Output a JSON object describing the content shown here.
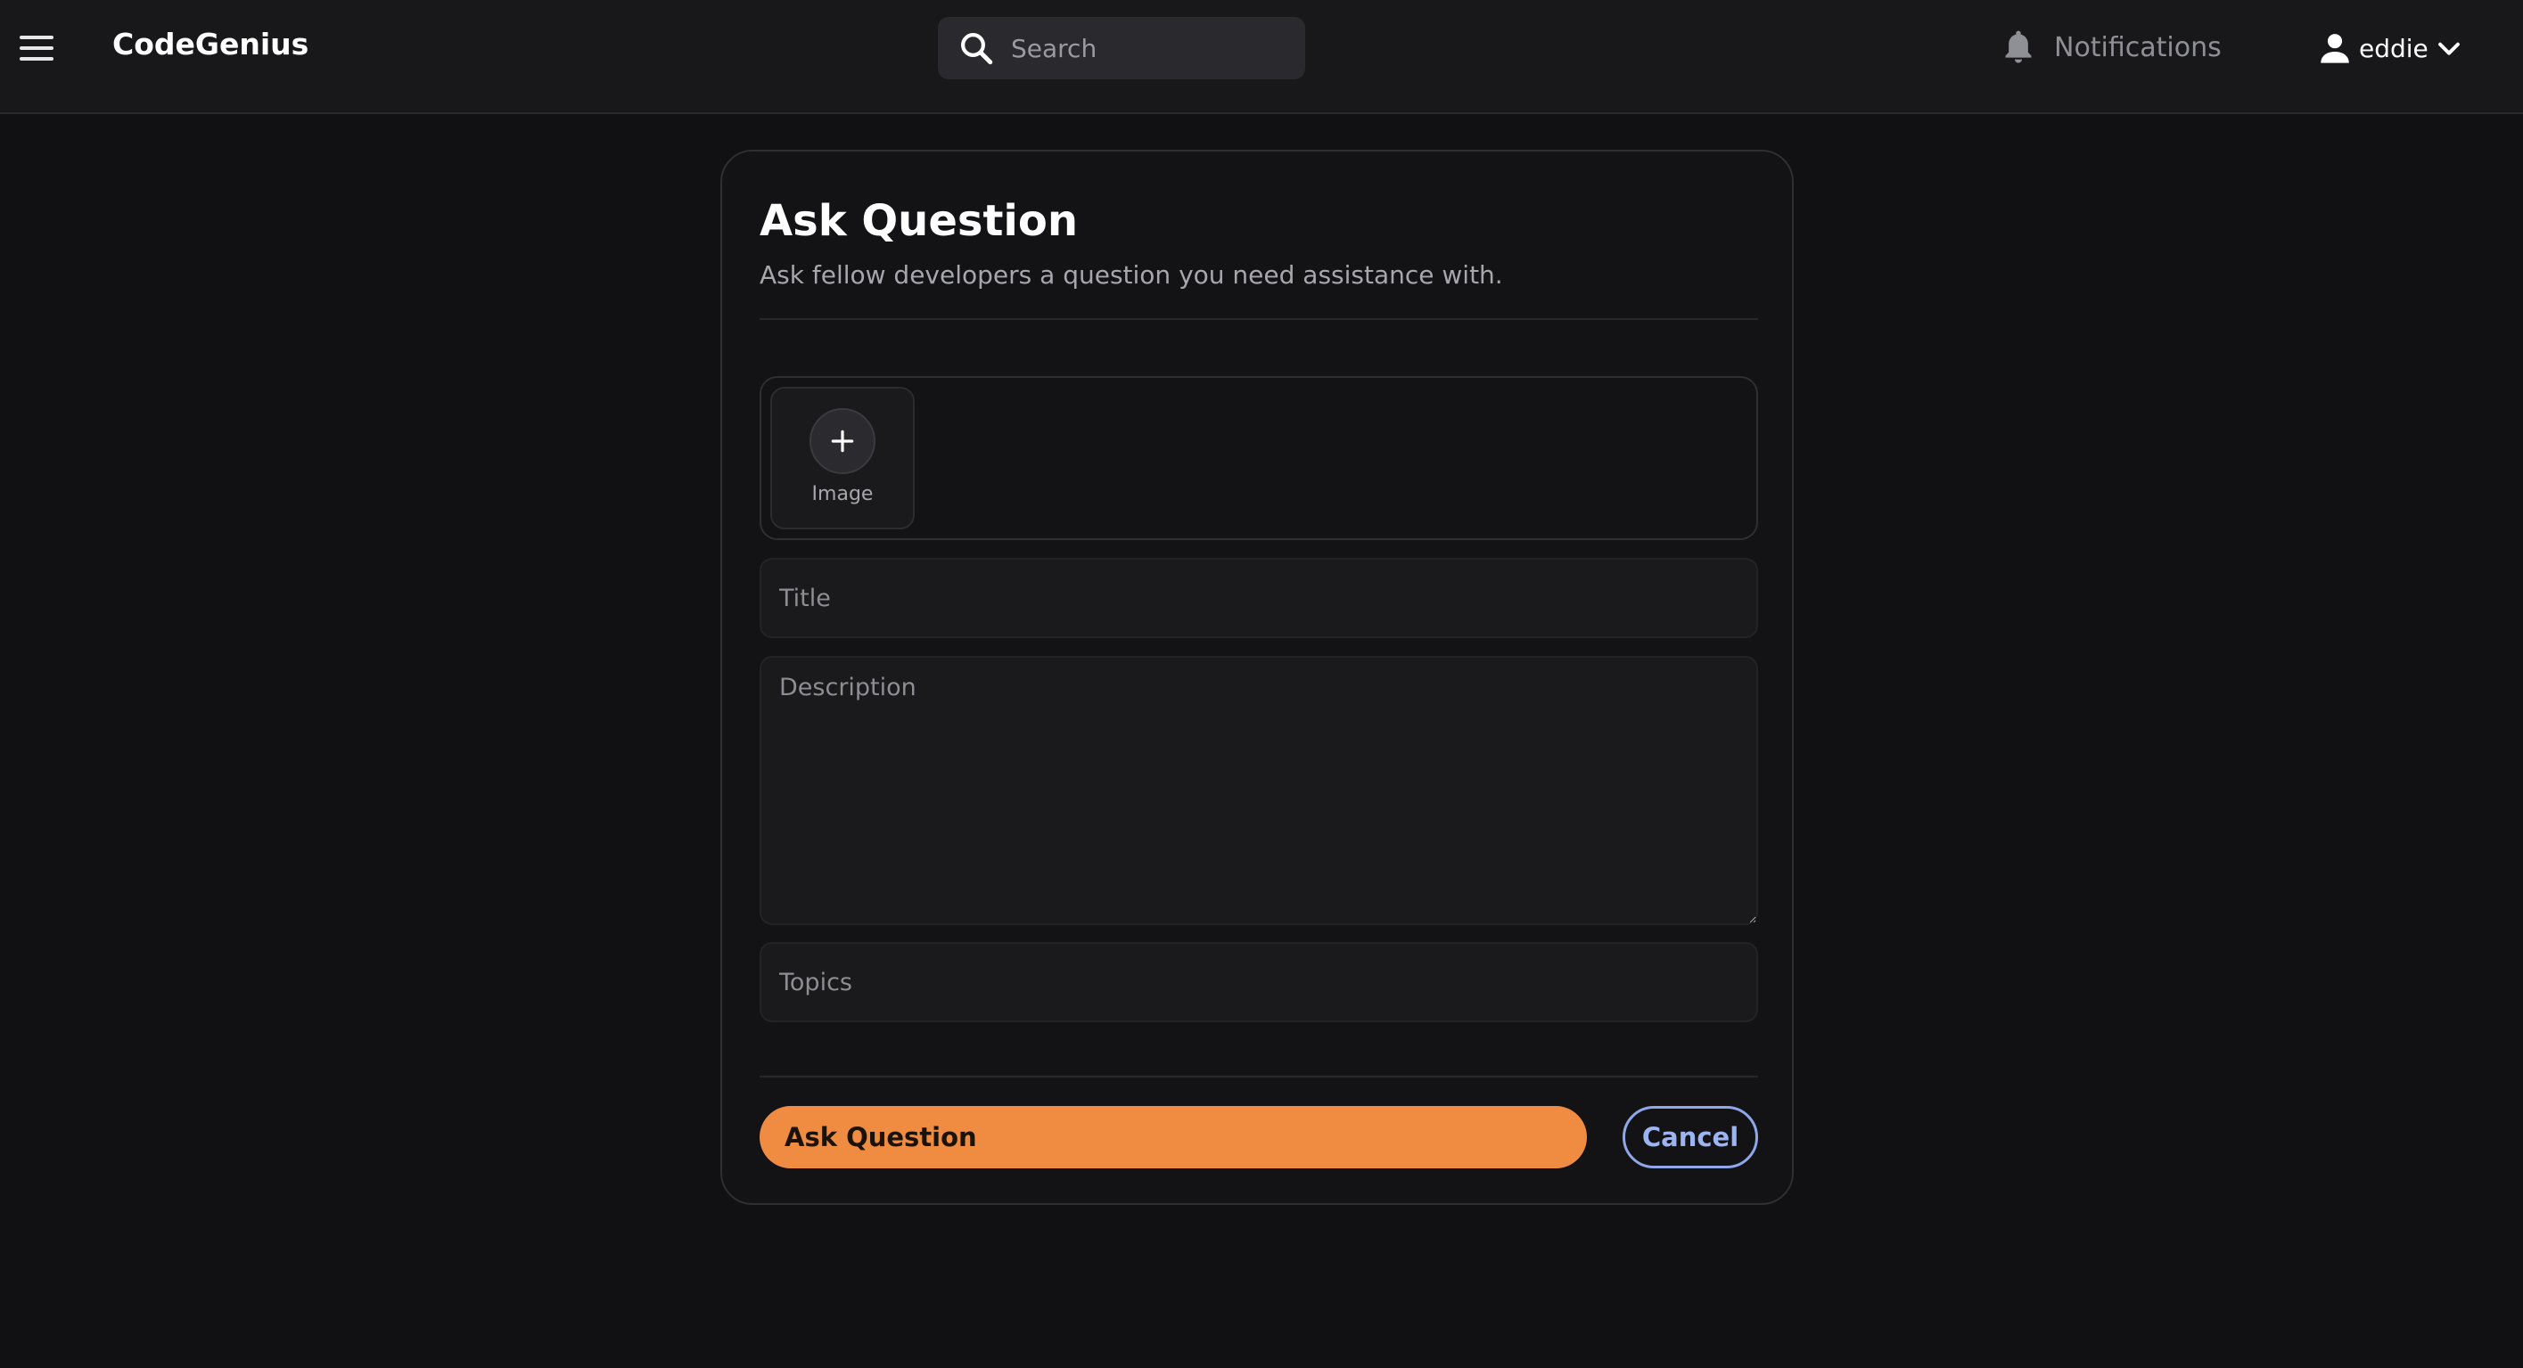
{
  "header": {
    "brand": "CodeGenius",
    "search_placeholder": "Search",
    "notifications_label": "Notifications",
    "user_name": "eddie",
    "icons": {
      "menu": "hamburger-menu-icon",
      "search": "search-icon",
      "notifications": "bell-icon",
      "user": "user-icon",
      "dropdown": "chevron-down-icon"
    }
  },
  "form": {
    "title": "Ask Question",
    "subtitle": "Ask fellow developers a question you need assistance with.",
    "image_upload_label": "Image",
    "image_upload_icon": "plus-icon",
    "title_placeholder": "Title",
    "description_placeholder": "Description",
    "topics_placeholder": "Topics",
    "submit_label": "Ask Question",
    "cancel_label": "Cancel"
  },
  "colors": {
    "background": "#111113",
    "header_bg": "#18181b",
    "accent": "#ef8c42",
    "secondary": "#8fa7e8"
  }
}
